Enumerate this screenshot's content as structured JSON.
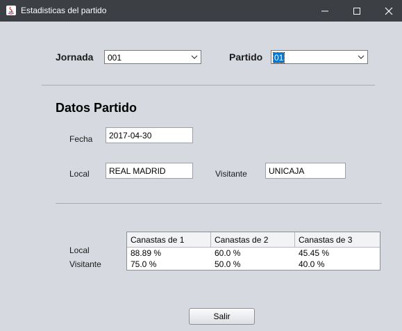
{
  "window": {
    "title": "Estadisticas del partido"
  },
  "filters": {
    "jornada_label": "Jornada",
    "jornada_value": "001",
    "partido_label": "Partido",
    "partido_value": "01"
  },
  "datos": {
    "title": "Datos Partido",
    "fecha_label": "Fecha",
    "fecha_value": "2017-04-30",
    "local_label": "Local",
    "local_value": "REAL MADRID",
    "visitante_label": "Visitante",
    "visitante_value": "UNICAJA"
  },
  "stats": {
    "row_labels": [
      "Local",
      "Visitante"
    ],
    "columns": [
      "Canastas de 1",
      "Canastas de 2",
      "Canastas de 3"
    ],
    "rows": [
      [
        "88.89 %",
        "60.0 %",
        "45.45 %"
      ],
      [
        "75.0 %",
        "50.0 %",
        "40.0 %"
      ]
    ]
  },
  "actions": {
    "exit_label": "Salir"
  }
}
